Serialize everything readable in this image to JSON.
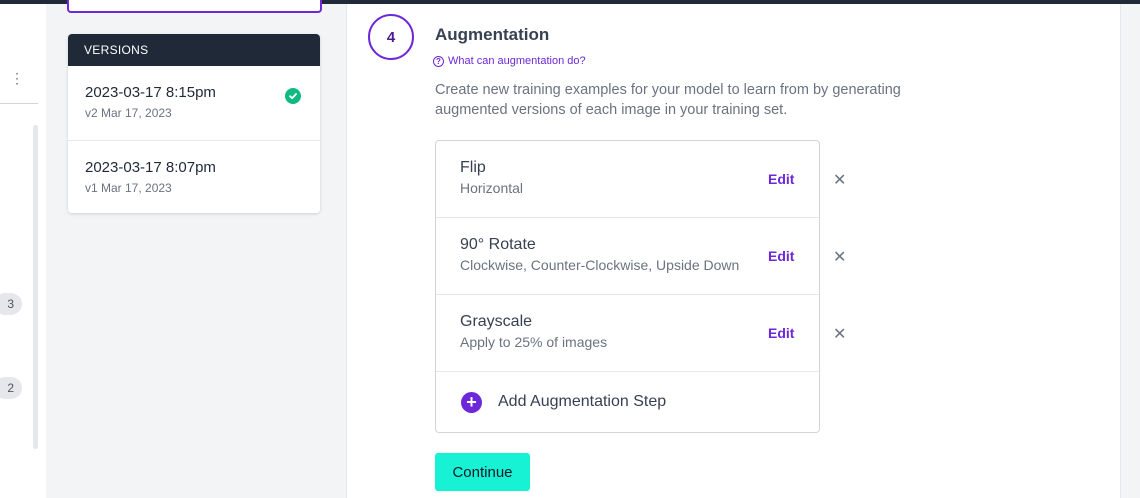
{
  "rail": {
    "badges": [
      "3",
      "2"
    ]
  },
  "versions": {
    "header": "VERSIONS",
    "items": [
      {
        "name": "2023-03-17 8:15pm",
        "sub": "v2 Mar 17, 2023",
        "selected": true
      },
      {
        "name": "2023-03-17 8:07pm",
        "sub": "v1 Mar 17, 2023",
        "selected": false
      }
    ]
  },
  "step": {
    "number": "4",
    "title": "Augmentation",
    "help_link": "What can augmentation do?",
    "description": "Create new training examples for your model to learn from by generating augmented versions of each image in your training set.",
    "augmentations": [
      {
        "name": "Flip",
        "detail": "Horizontal",
        "edit_label": "Edit"
      },
      {
        "name": "90° Rotate",
        "detail": "Clockwise, Counter-Clockwise, Upside Down",
        "edit_label": "Edit"
      },
      {
        "name": "Grayscale",
        "detail": "Apply to 25% of images",
        "edit_label": "Edit"
      }
    ],
    "add_step_label": "Add Augmentation Step",
    "continue_label": "Continue"
  },
  "colors": {
    "accent": "#6d28d9",
    "success": "#10b981",
    "continue_bg": "#17f2d5",
    "header_bg": "#1f2937"
  }
}
